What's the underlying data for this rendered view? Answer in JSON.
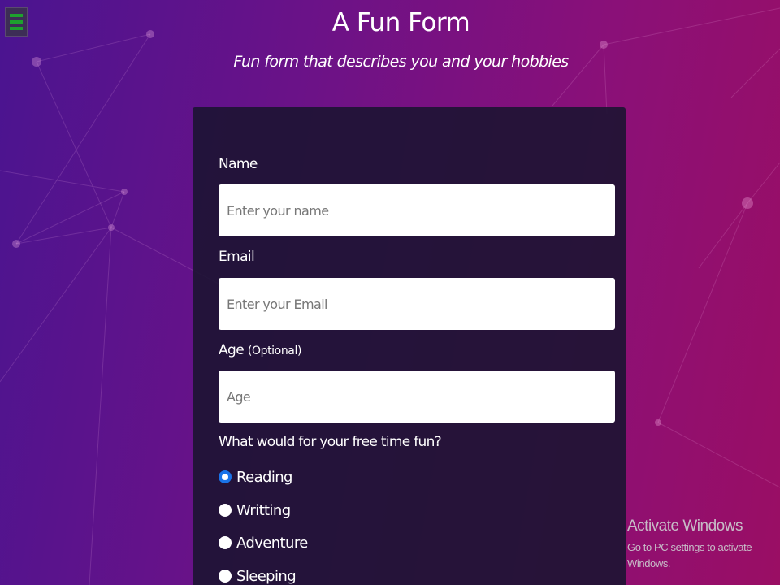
{
  "header": {
    "title": "A Fun Form",
    "subtitle": "Fun form that describes you and your hobbies"
  },
  "menu": {
    "icon": "hamburger-menu-icon",
    "accent_color": "#1ea12e"
  },
  "form": {
    "name_label": "Name",
    "name_placeholder": "Enter your name",
    "name_value": "",
    "email_label": "Email",
    "email_placeholder": "Enter your Email",
    "email_value": "",
    "age_label": "Age",
    "age_hint": "(Optional)",
    "age_placeholder": "Age",
    "age_value": "",
    "question": "What would for your free time fun?",
    "options": [
      {
        "label": "Reading",
        "selected": true
      },
      {
        "label": "Writting",
        "selected": false
      },
      {
        "label": "Adventure",
        "selected": false
      },
      {
        "label": "Sleeping",
        "selected": false
      }
    ]
  },
  "watermark": {
    "title": "Activate Windows",
    "subtitle": "Go to PC settings to activate Windows."
  },
  "colors": {
    "bg_left": "#4a1490",
    "bg_right": "#9a0e64",
    "card": "#1c1432",
    "radio_checked": "#1a73e8"
  }
}
